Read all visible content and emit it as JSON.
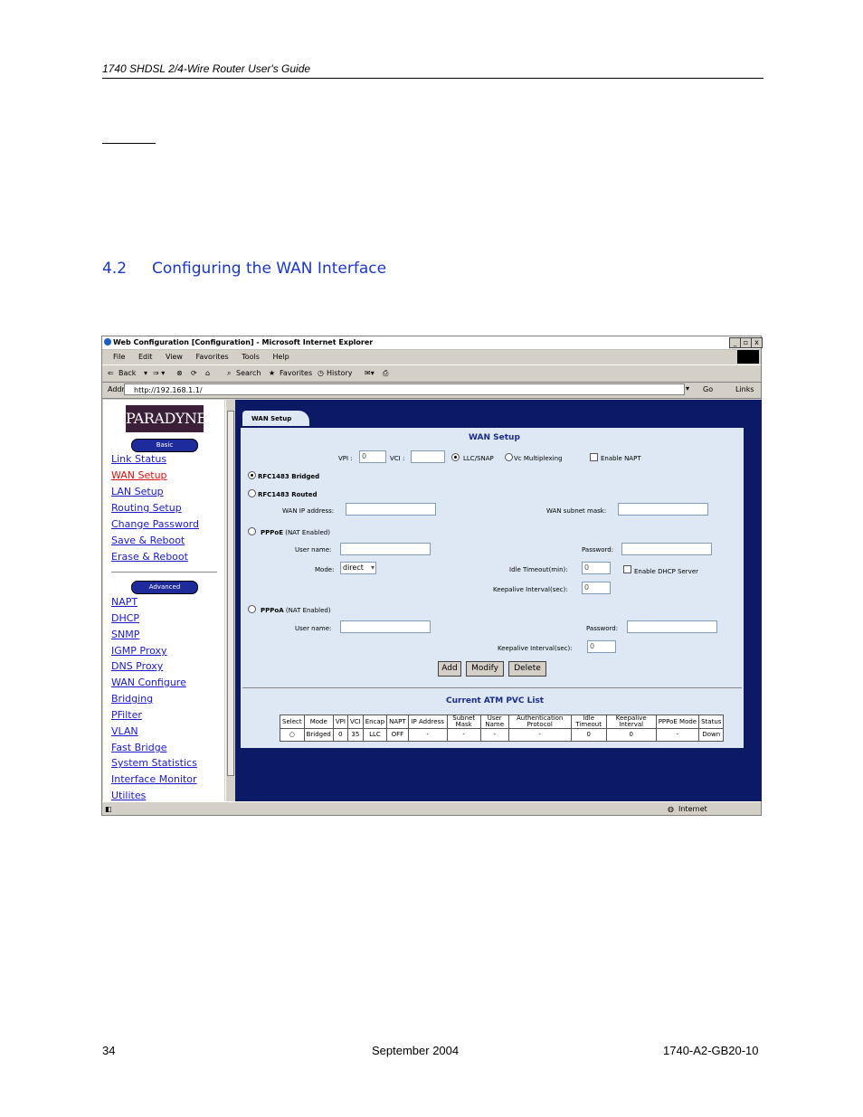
{
  "document": {
    "header": "1740 SHDSL 2/4-Wire Router User's Guide",
    "section_number": "4.2",
    "section_title": "Configuring the WAN Interface",
    "footer_page": "34",
    "footer_date": "September 2004",
    "footer_docnum": "1740-A2-GB20-10"
  },
  "browser": {
    "title": "Web Configuration [Configuration] - Microsoft Internet Explorer",
    "window_buttons": [
      "_",
      "▫",
      "x"
    ],
    "menu": [
      "File",
      "Edit",
      "View",
      "Favorites",
      "Tools",
      "Help"
    ],
    "toolbar": {
      "back": "Back",
      "search": "Search",
      "favorites": "Favorites",
      "history": "History"
    },
    "address_label": "Address",
    "address": "http://192.168.1.1/",
    "go": "Go",
    "links": "Links",
    "status_zone": "Internet"
  },
  "sidebar": {
    "logo": "PARADYNE",
    "basic_label": "Basic",
    "basic_items": [
      "Link Status",
      "WAN Setup",
      "LAN Setup",
      "Routing Setup",
      "Change Password",
      "Save & Reboot",
      "Erase & Reboot"
    ],
    "active_item": "WAN Setup",
    "advanced_label": "Advanced",
    "advanced_items": [
      "NAPT",
      "DHCP",
      "SNMP",
      "IGMP Proxy",
      "DNS Proxy",
      "WAN Configure",
      "Bridging",
      "PFilter",
      "VLAN",
      "Fast Bridge",
      "System Statistics",
      "Interface Monitor",
      "Utilites"
    ]
  },
  "wan": {
    "tab": "WAN Setup",
    "heading": "WAN Setup",
    "vpi_label": "VPI :",
    "vpi_value": "0",
    "vci_label": "VCI :",
    "vci_value": "",
    "llc_label": "LLC/SNAP",
    "vc_label": "Vc Multiplexing",
    "napt_label": "Enable NAPT",
    "rfc_bridged": "RFC1483 Bridged",
    "rfc_routed": "RFC1483 Routed",
    "wan_ip_label": "WAN IP address:",
    "wan_mask_label": "WAN subnet mask:",
    "pppoe_label": "PPPoE",
    "pppoe_note": "(NAT Enabled)",
    "user_label": "User name:",
    "password_label": "Password:",
    "mode_label": "Mode:",
    "mode_value": "direct",
    "idle_label": "Idle Timeout(min):",
    "idle_value": "0",
    "dhcp_label": "Enable DHCP Server",
    "keepalive_label": "Keepalive Interval(sec):",
    "keepalive_value": "0",
    "pppoa_label": "PPPoA",
    "pppoa_note": "(NAT Enabled)",
    "pppoa_keepalive_value": "0",
    "buttons": [
      "Add",
      "Modify",
      "Delete"
    ],
    "list_heading": "Current ATM PVC List",
    "table_headers": [
      "Select",
      "Mode",
      "VPI",
      "VCI",
      "Encap",
      "NAPT",
      "IP Address",
      "Subnet Mask",
      "User Name",
      "Authentication Protocol",
      "Idle Timeout",
      "Keepalive Interval",
      "PPPoE Mode",
      "Status"
    ],
    "table_rows": [
      [
        "○",
        "Bridged",
        "0",
        "35",
        "LLC",
        "OFF",
        "-",
        "-",
        "-",
        "-",
        "0",
        "0",
        "-",
        "Down"
      ]
    ]
  }
}
